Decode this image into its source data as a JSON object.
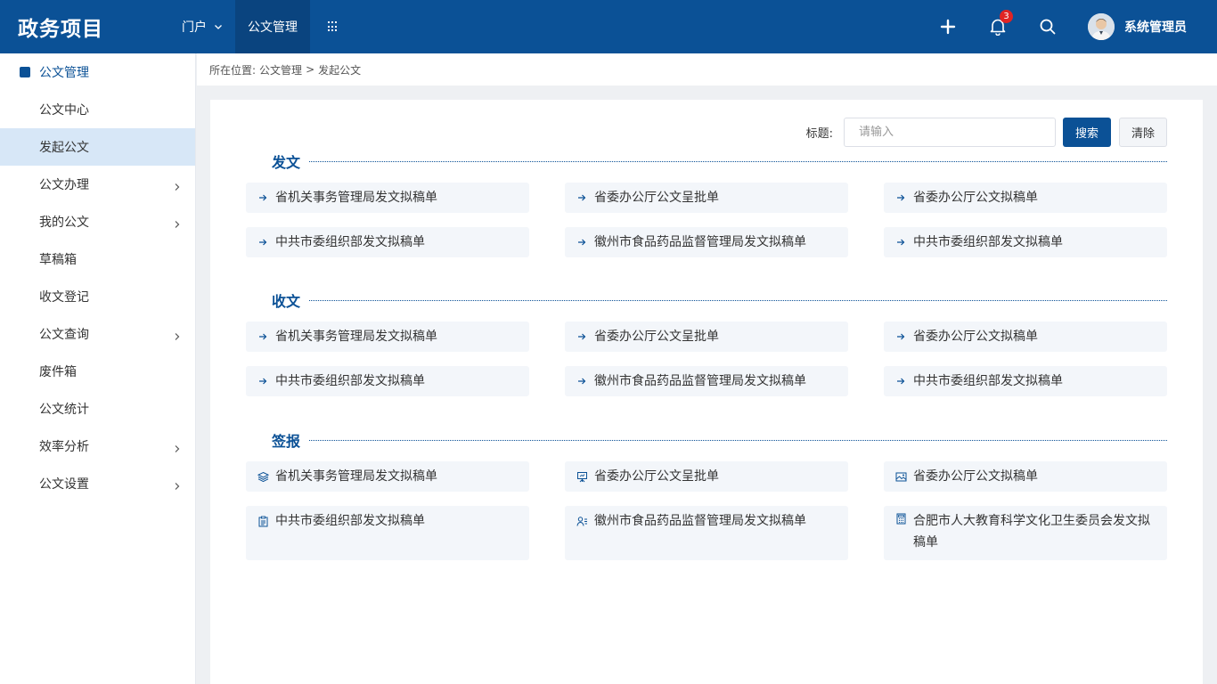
{
  "app": {
    "title": "政务项目"
  },
  "nav": {
    "items": [
      {
        "label": "门户",
        "has_dropdown": true,
        "active": false
      },
      {
        "label": "公文管理",
        "has_dropdown": false,
        "active": true
      }
    ],
    "apps_icon": "grid-icon"
  },
  "header": {
    "add_icon": "plus-icon",
    "bell_icon": "bell-icon",
    "notification_count": "3",
    "search_icon": "search-icon",
    "user_name": "系统管理员"
  },
  "sidebar": {
    "title": "公文管理",
    "items": [
      {
        "label": "公文中心",
        "has_children": false,
        "active": false
      },
      {
        "label": "发起公文",
        "has_children": false,
        "active": true
      },
      {
        "label": "公文办理",
        "has_children": true,
        "active": false
      },
      {
        "label": "我的公文",
        "has_children": true,
        "active": false
      },
      {
        "label": "草稿箱",
        "has_children": false,
        "active": false
      },
      {
        "label": "收文登记",
        "has_children": false,
        "active": false
      },
      {
        "label": "公文查询",
        "has_children": true,
        "active": false
      },
      {
        "label": "废件箱",
        "has_children": false,
        "active": false
      },
      {
        "label": "公文统计",
        "has_children": false,
        "active": false
      },
      {
        "label": "效率分析",
        "has_children": true,
        "active": false
      },
      {
        "label": "公文设置",
        "has_children": true,
        "active": false
      }
    ]
  },
  "breadcrumb": {
    "prefix": "所在位置:",
    "path": [
      "公文管理",
      "发起公文"
    ],
    "separator": ">"
  },
  "search": {
    "label": "标题:",
    "placeholder": "请输入",
    "value": "",
    "search_label": "搜索",
    "clear_label": "清除"
  },
  "sections": [
    {
      "title": "发文",
      "items": [
        {
          "label": "省机关事务管理局发文拟稿单",
          "icon": "arrow-right-icon"
        },
        {
          "label": "省委办公厅公文呈批单",
          "icon": "arrow-right-icon"
        },
        {
          "label": "省委办公厅公文拟稿单",
          "icon": "arrow-right-icon"
        },
        {
          "label": "中共市委组织部发文拟稿单",
          "icon": "arrow-right-icon"
        },
        {
          "label": "徽州市食品药品监督管理局发文拟稿单",
          "icon": "arrow-right-icon"
        },
        {
          "label": "中共市委组织部发文拟稿单",
          "icon": "arrow-right-icon"
        }
      ]
    },
    {
      "title": "收文",
      "items": [
        {
          "label": "省机关事务管理局发文拟稿单",
          "icon": "arrow-right-icon"
        },
        {
          "label": "省委办公厅公文呈批单",
          "icon": "arrow-right-icon"
        },
        {
          "label": "省委办公厅公文拟稿单",
          "icon": "arrow-right-icon"
        },
        {
          "label": "中共市委组织部发文拟稿单",
          "icon": "arrow-right-icon"
        },
        {
          "label": "徽州市食品药品监督管理局发文拟稿单",
          "icon": "arrow-right-icon"
        },
        {
          "label": "中共市委组织部发文拟稿单",
          "icon": "arrow-right-icon"
        }
      ]
    },
    {
      "title": "签报",
      "items": [
        {
          "label": "省机关事务管理局发文拟稿单",
          "icon": "layers-icon"
        },
        {
          "label": "省委办公厅公文呈批单",
          "icon": "presentation-icon"
        },
        {
          "label": "省委办公厅公文拟稿单",
          "icon": "image-card-icon"
        },
        {
          "label": "中共市委组织部发文拟稿单",
          "icon": "clipboard-icon"
        },
        {
          "label": "徽州市食品药品监督管理局发文拟稿单",
          "icon": "user-list-icon"
        },
        {
          "label": "合肥市人大教育科学文化卫生委员会发文拟稿单",
          "icon": "calculator-icon"
        }
      ]
    }
  ],
  "colors": {
    "primary": "#0b5196",
    "header_active": "#0a447f",
    "sidebar_active": "#d7e7f7",
    "card_bg": "#f3f6fa",
    "badge": "#e02424"
  }
}
